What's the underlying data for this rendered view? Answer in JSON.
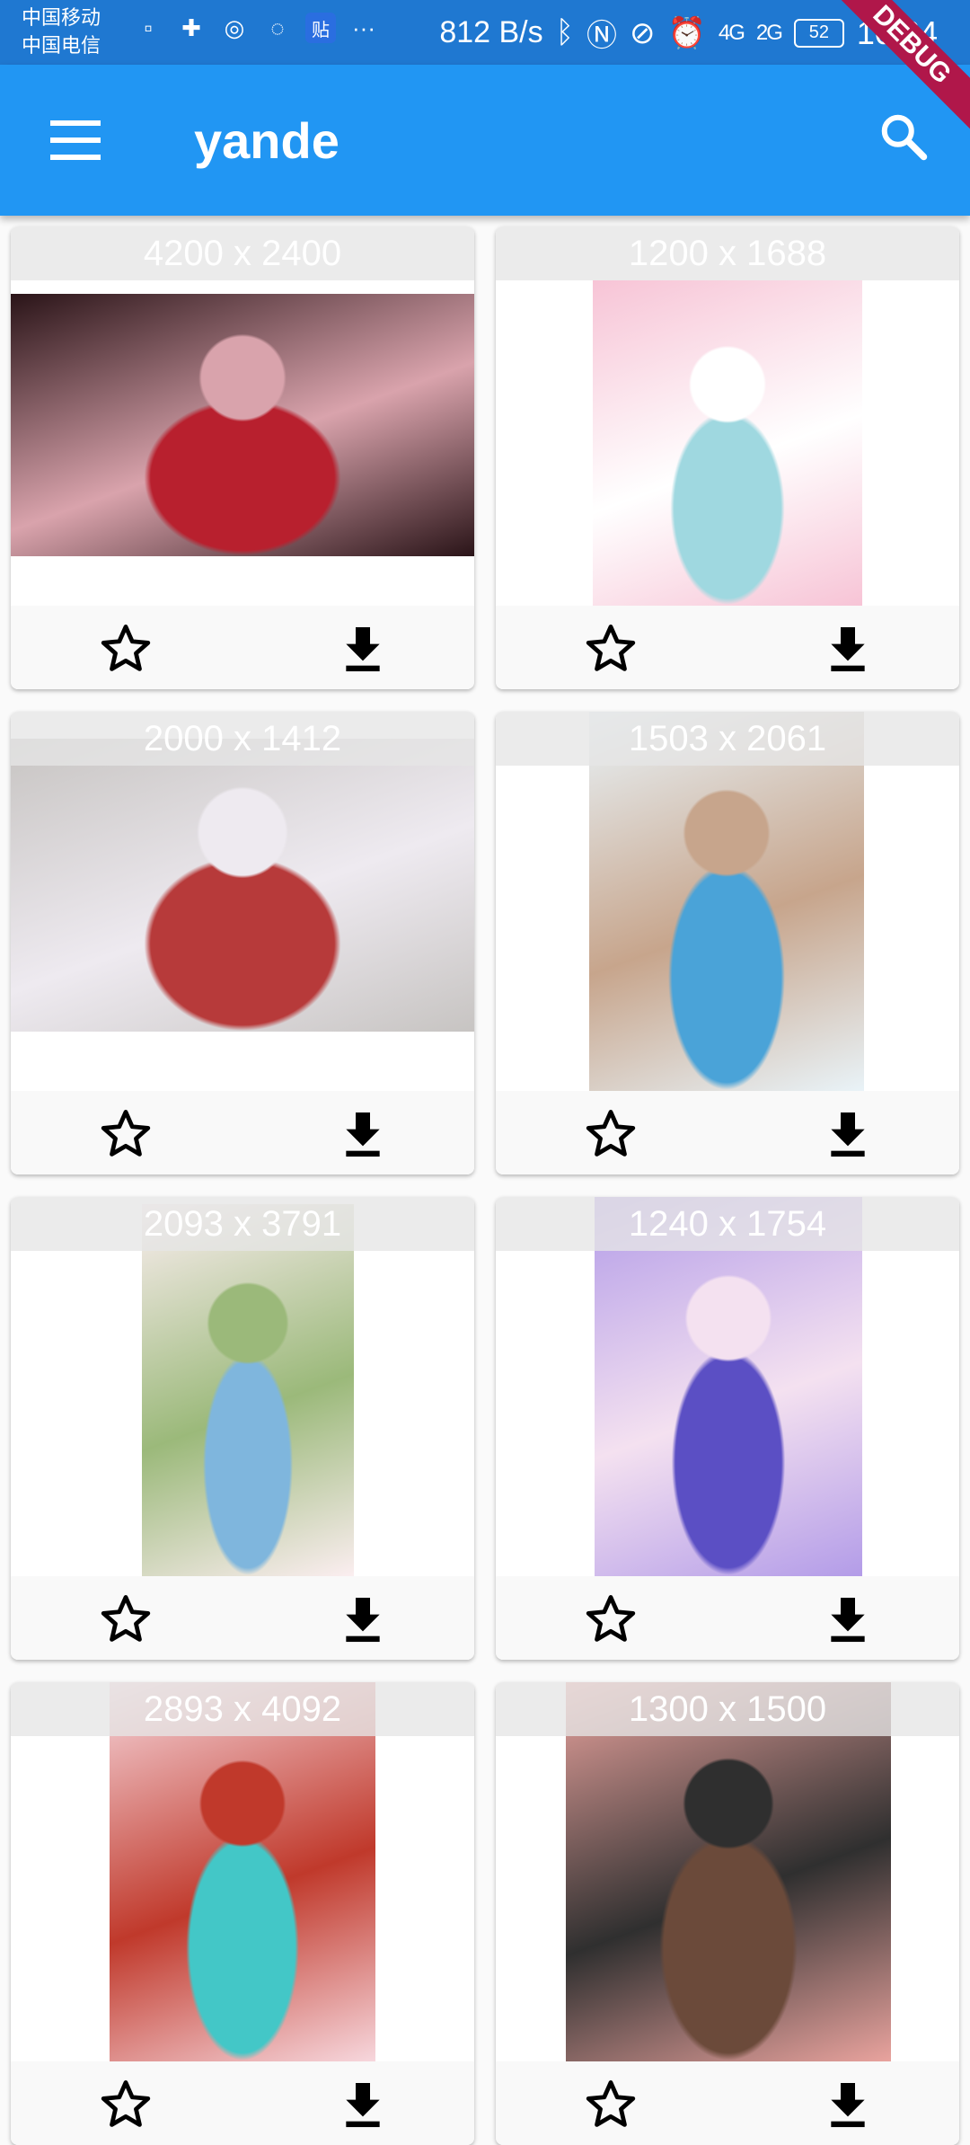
{
  "status_bar": {
    "carrier_1": "中国移动",
    "carrier_2": "中国电信",
    "notification_badge": "贴",
    "overflow": "···",
    "net_speed": "812 B/s",
    "signal_1": "4G",
    "signal_2": "2G",
    "battery": "52",
    "time": "10:34"
  },
  "app_bar": {
    "title": "yande",
    "debug_banner": "DEBUG"
  },
  "posts": [
    {
      "size": "4200 x 2400",
      "colors": [
        "#2a1418",
        "#b8202e",
        "#d9a3ac"
      ]
    },
    {
      "size": "1200 x 1688",
      "colors": [
        "#f7c4d6",
        "#9fd8e0",
        "#ffffff"
      ]
    },
    {
      "size": "2000 x 1412",
      "colors": [
        "#c7c4c2",
        "#b73a3a",
        "#eeeaf0"
      ]
    },
    {
      "size": "1503 x 2061",
      "colors": [
        "#e9f3f8",
        "#4aa3d8",
        "#c7a58c"
      ]
    },
    {
      "size": "2093 x 3791",
      "colors": [
        "#fbeef0",
        "#7fb6dd",
        "#9bb97a"
      ]
    },
    {
      "size": "1240 x 1754",
      "colors": [
        "#b39ce8",
        "#5b4fc4",
        "#f4e1f0"
      ]
    },
    {
      "size": "2893 x 4092",
      "colors": [
        "#f7d7dd",
        "#43c7c7",
        "#c0392b"
      ]
    },
    {
      "size": "1300 x 1500",
      "colors": [
        "#e9a39e",
        "#6b4a3a",
        "#2f2f2f"
      ]
    }
  ]
}
